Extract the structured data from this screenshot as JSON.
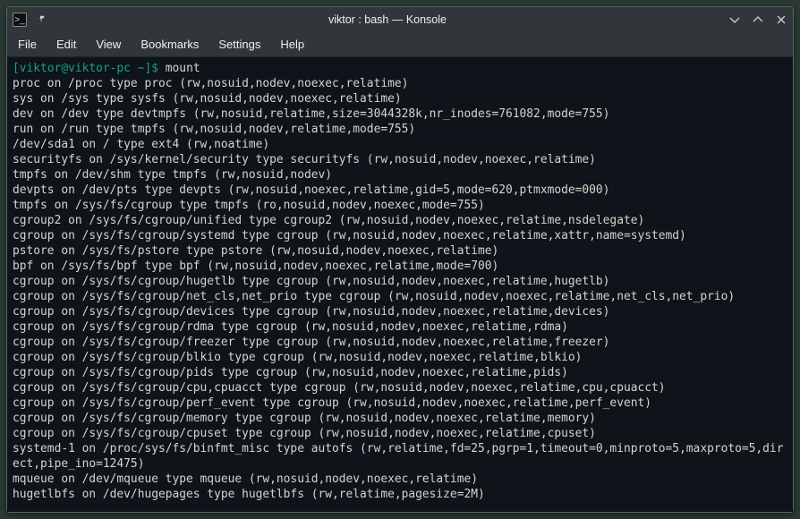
{
  "titlebar": {
    "title": "viktor : bash — Konsole"
  },
  "menubar": {
    "items": [
      "File",
      "Edit",
      "View",
      "Bookmarks",
      "Settings",
      "Help"
    ]
  },
  "terminal": {
    "prompt": {
      "open": "[",
      "user_host": "viktor@viktor-pc",
      "space_path": " ~",
      "close": "]$ "
    },
    "command": "mount",
    "output": [
      "proc on /proc type proc (rw,nosuid,nodev,noexec,relatime)",
      "sys on /sys type sysfs (rw,nosuid,nodev,noexec,relatime)",
      "dev on /dev type devtmpfs (rw,nosuid,relatime,size=3044328k,nr_inodes=761082,mode=755)",
      "run on /run type tmpfs (rw,nosuid,nodev,relatime,mode=755)",
      "/dev/sda1 on / type ext4 (rw,noatime)",
      "securityfs on /sys/kernel/security type securityfs (rw,nosuid,nodev,noexec,relatime)",
      "tmpfs on /dev/shm type tmpfs (rw,nosuid,nodev)",
      "devpts on /dev/pts type devpts (rw,nosuid,noexec,relatime,gid=5,mode=620,ptmxmode=000)",
      "tmpfs on /sys/fs/cgroup type tmpfs (ro,nosuid,nodev,noexec,mode=755)",
      "cgroup2 on /sys/fs/cgroup/unified type cgroup2 (rw,nosuid,nodev,noexec,relatime,nsdelegate)",
      "cgroup on /sys/fs/cgroup/systemd type cgroup (rw,nosuid,nodev,noexec,relatime,xattr,name=systemd)",
      "pstore on /sys/fs/pstore type pstore (rw,nosuid,nodev,noexec,relatime)",
      "bpf on /sys/fs/bpf type bpf (rw,nosuid,nodev,noexec,relatime,mode=700)",
      "cgroup on /sys/fs/cgroup/hugetlb type cgroup (rw,nosuid,nodev,noexec,relatime,hugetlb)",
      "cgroup on /sys/fs/cgroup/net_cls,net_prio type cgroup (rw,nosuid,nodev,noexec,relatime,net_cls,net_prio)",
      "cgroup on /sys/fs/cgroup/devices type cgroup (rw,nosuid,nodev,noexec,relatime,devices)",
      "cgroup on /sys/fs/cgroup/rdma type cgroup (rw,nosuid,nodev,noexec,relatime,rdma)",
      "cgroup on /sys/fs/cgroup/freezer type cgroup (rw,nosuid,nodev,noexec,relatime,freezer)",
      "cgroup on /sys/fs/cgroup/blkio type cgroup (rw,nosuid,nodev,noexec,relatime,blkio)",
      "cgroup on /sys/fs/cgroup/pids type cgroup (rw,nosuid,nodev,noexec,relatime,pids)",
      "cgroup on /sys/fs/cgroup/cpu,cpuacct type cgroup (rw,nosuid,nodev,noexec,relatime,cpu,cpuacct)",
      "cgroup on /sys/fs/cgroup/perf_event type cgroup (rw,nosuid,nodev,noexec,relatime,perf_event)",
      "cgroup on /sys/fs/cgroup/memory type cgroup (rw,nosuid,nodev,noexec,relatime,memory)",
      "cgroup on /sys/fs/cgroup/cpuset type cgroup (rw,nosuid,nodev,noexec,relatime,cpuset)",
      "systemd-1 on /proc/sys/fs/binfmt_misc type autofs (rw,relatime,fd=25,pgrp=1,timeout=0,minproto=5,maxproto=5,direct,pipe_ino=12475)",
      "mqueue on /dev/mqueue type mqueue (rw,nosuid,nodev,noexec,relatime)",
      "hugetlbfs on /dev/hugepages type hugetlbfs (rw,relatime,pagesize=2M)"
    ]
  }
}
